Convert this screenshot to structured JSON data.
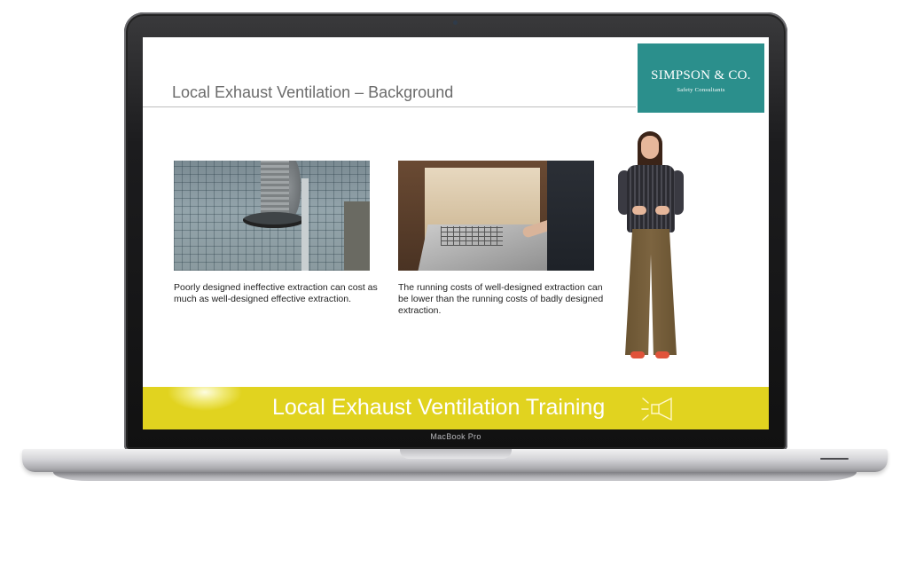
{
  "device": {
    "model_label": "MacBook Pro"
  },
  "slide": {
    "title": "Local Exhaust Ventilation – Background",
    "logo": {
      "name": "SIMPSON & CO.",
      "tagline": "Safety Consultants",
      "color": "#2b8f8c"
    },
    "panels": [
      {
        "image_icon": "extraction-hood-photo",
        "caption": "Poorly designed ineffective extraction can cost as much as well-designed effective extraction."
      },
      {
        "image_icon": "extraction-booth-photo",
        "caption": "The running costs of well-designed extraction can be lower than the running costs of badly designed extraction."
      }
    ],
    "banner": {
      "text": "Local Exhaust Ventilation Training",
      "icon": "megaphone-icon",
      "color": "#e1d31f"
    }
  }
}
